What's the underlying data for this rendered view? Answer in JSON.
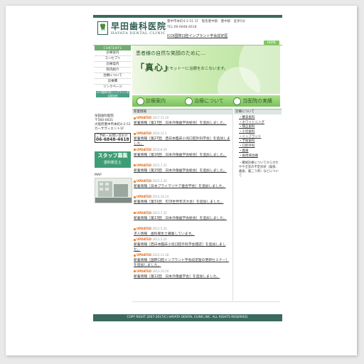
{
  "header": {
    "site_name": "早田歯科医院",
    "site_name_en": "HAYATA DENTAL CLINIC",
    "address": "豊中市本町4-2-51 1F　阪急豊中駅　豊中駅　徒歩5分",
    "tel": "TEL:06-6848-4618",
    "link": "ICOI国際口腔インプラント学会認定医",
    "home_label": "HOME"
  },
  "sidebar": {
    "head": "CONTENTS",
    "items": [
      {
        "label": "診療案内"
      },
      {
        "label": "コンセプト"
      },
      {
        "label": "診療案内"
      },
      {
        "label": "院内紹介"
      },
      {
        "label": "治療について"
      },
      {
        "label": "診療費"
      }
    ],
    "link": "リンクページ",
    "banner": "ICOI国際口腔インプラント学会認定医"
  },
  "hero": {
    "tagline": "患者様の自然な笑顔のために…",
    "quote": "「真心」",
    "motto": "をモットーに治療をおこないます。"
  },
  "tabs": [
    {
      "label": "診療案内"
    },
    {
      "label": "治療について"
    },
    {
      "label": "当医院の実績"
    }
  ],
  "news": {
    "heading": "新着情報",
    "badge": "UPDATED",
    "entries": [
      {
        "date": "2017.11.10",
        "title": "新着情報［第17回　日本外傷歯学会総会］を追加しました。"
      },
      {
        "date": "2016.11.1",
        "title": "新着情報［第27回　西日本臨床小児口腔外科学会］を追加しました。"
      },
      {
        "date": "2016.8.29",
        "title": "新着情報［第16回　日本外傷歯学会総会］を追加しました。"
      },
      {
        "date": "2015.7.31",
        "title": "新着情報［第15回　日本外傷歯学会総会］を追加しました。"
      },
      {
        "date": "2015.2.20",
        "title": "新着情報［日本プライマリケア連合学会］を追加しました。"
      },
      {
        "date": "2014.10.14",
        "title": "新着情報［第31回　ICOI世界年次大会］を追加しました。"
      },
      {
        "date": "2013.7.31",
        "title": "新着情報［第13回　日本外傷歯学会総会］を追加しました。"
      },
      {
        "date": "2013.5.24",
        "title": "求人情報　歯科衛生士募集しています。"
      },
      {
        "date": "2013.5.20",
        "title": "新着情報［西日本臨床小児口腔外科学会雑誌］を追加しました。"
      },
      {
        "date": "2012.11.28",
        "title": "新着情報［国際口腔インプラント学会認定医の更新セミナー］を追加しました。"
      },
      {
        "date": "2013.10.20",
        "title": "新着情報［第12回　日本外傷歯学会］を追加しました。"
      }
    ]
  },
  "info": {
    "heading": "診療について",
    "items": [
      {
        "label": "・審美歯科"
      },
      {
        "label": "・ホワイトニング"
      },
      {
        "label": "・矯正歯科"
      },
      {
        "label": "・小児歯科"
      },
      {
        "label": "・インプラント"
      },
      {
        "label": "・予防歯科"
      },
      {
        "label": "・口腔外科"
      },
      {
        "label": "・義歯"
      },
      {
        "label": "・歯周病治療"
      }
    ],
    "note": "・積極診療についてからカセやや全室の不定形状（擬掛、義歯、義こう骨）などについて"
  },
  "clinic": {
    "name": "早田歯科医院",
    "zip": "〒560-0021",
    "address": "大阪府豊中市本町4-2-51",
    "building": "カーサヴィエント1F",
    "tel_label": "ご予約・お問い合わせ",
    "tel": "06-6848-4618"
  },
  "recruit": {
    "title": "スタッフ募集",
    "subtitle": "歯科衛生士"
  },
  "map_label": "MAP",
  "footer": "COPY RIGHT 2007-2017(C) HAYATA DENTAL CLINIC,INC. ALL RIGHTS RESERVED.",
  "colors": {
    "brand": "#3a6a5e",
    "accent": "#78c25a",
    "update": "#e06a1a"
  }
}
